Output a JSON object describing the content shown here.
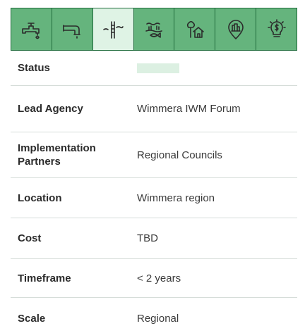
{
  "icons": [
    {
      "name": "tap-water-icon",
      "active": false
    },
    {
      "name": "pipe-outlet-icon",
      "active": false
    },
    {
      "name": "riverbank-icon",
      "active": true
    },
    {
      "name": "wetland-fish-icon",
      "active": false
    },
    {
      "name": "home-trees-icon",
      "active": false
    },
    {
      "name": "location-pin-city-icon",
      "active": false
    },
    {
      "name": "money-lightbulb-icon",
      "active": false
    }
  ],
  "colors": {
    "icon_bg": "#65b47d",
    "icon_active_bg": "#dff3e5",
    "border": "#1f6b3b",
    "status_bar": "#dcf0e2"
  },
  "rows": {
    "status": {
      "label": "Status"
    },
    "lead_agency": {
      "label": "Lead Agency",
      "value": "Wimmera IWM Forum"
    },
    "partners": {
      "label": "Implementation Partners",
      "value": "Regional Councils"
    },
    "location": {
      "label": "Location",
      "value": "Wimmera region"
    },
    "cost": {
      "label": "Cost",
      "value": "TBD"
    },
    "timeframe": {
      "label": "Timeframe",
      "value": "< 2 years"
    },
    "scale": {
      "label": "Scale",
      "value": "Regional"
    }
  }
}
